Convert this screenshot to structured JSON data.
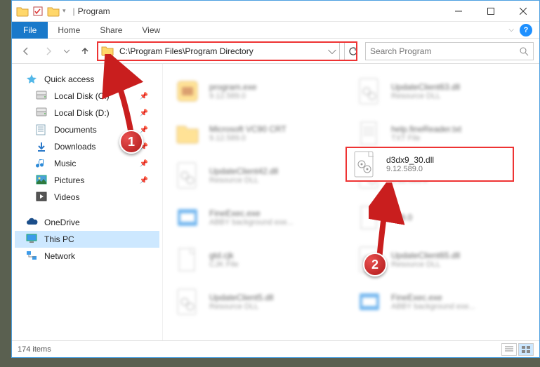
{
  "window": {
    "title": "Program"
  },
  "ribbon": {
    "file": "File",
    "home": "Home",
    "share": "Share",
    "view": "View"
  },
  "nav": {
    "address": "C:\\Program Files\\Program Directory",
    "search_placeholder": "Search Program"
  },
  "sidebar": {
    "items": [
      {
        "icon": "star",
        "label": "Quick access",
        "top": true
      },
      {
        "icon": "drive",
        "label": "Local Disk (C:)",
        "pin": true
      },
      {
        "icon": "drive",
        "label": "Local Disk (D:)",
        "pin": true
      },
      {
        "icon": "docs",
        "label": "Documents",
        "pin": true
      },
      {
        "icon": "download",
        "label": "Downloads",
        "pin": true
      },
      {
        "icon": "music",
        "label": "Music",
        "pin": true
      },
      {
        "icon": "pictures",
        "label": "Pictures",
        "pin": true
      },
      {
        "icon": "videos",
        "label": "Videos"
      },
      {
        "icon": "onedrive",
        "label": "OneDrive",
        "top": true,
        "spacer": true
      },
      {
        "icon": "pc",
        "label": "This PC",
        "top": true,
        "selected": true
      },
      {
        "icon": "network",
        "label": "Network",
        "top": true
      }
    ]
  },
  "files": {
    "col1": [
      {
        "icon": "exe",
        "name": "program.exe",
        "sub": "9.12.589.0"
      },
      {
        "icon": "folder",
        "name": "Microsoft VC90 CRT",
        "sub": "9.12.589.0"
      },
      {
        "icon": "dll",
        "name": "UpdateClient42.dll",
        "sub": "Resource DLL"
      },
      {
        "icon": "exe2",
        "name": "FineExec.exe",
        "sub": "ABBY background exe..."
      },
      {
        "icon": "file",
        "name": "gtd.cjk",
        "sub": "CJK File"
      },
      {
        "icon": "dll",
        "name": "UpdateClient5.dll",
        "sub": "Resource DLL"
      }
    ],
    "col2": [
      {
        "icon": "dll",
        "name": "UpdateClient63.dll",
        "sub": "Resource DLL"
      },
      {
        "icon": "txt",
        "name": "help.fineReader.txt",
        "sub": "TXT File"
      },
      {
        "icon": "dll",
        "name": "d3dx9_30.dll",
        "sub": "9.12.589.0"
      },
      {
        "icon": "file",
        "name": "589.0",
        "sub": ""
      },
      {
        "icon": "dll",
        "name": "UpdateClient65.dll",
        "sub": "Resource DLL"
      },
      {
        "icon": "exe2",
        "name": "FineExec.exe",
        "sub": "ABBY background exe..."
      }
    ],
    "highlight": {
      "name": "d3dx9_30.dll",
      "sub": "9.12.589.0"
    }
  },
  "status": {
    "items": "174 items"
  },
  "annotations": {
    "badge1": "1",
    "badge2": "2"
  }
}
